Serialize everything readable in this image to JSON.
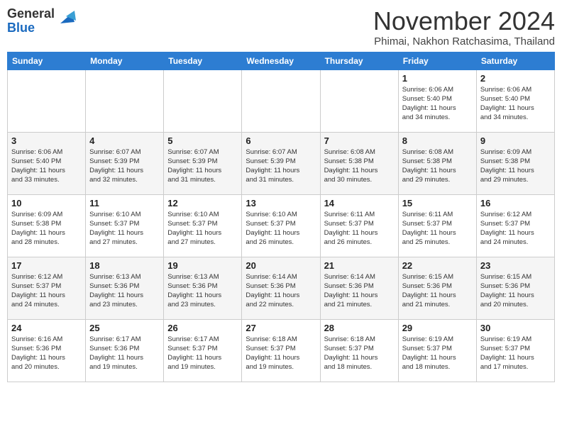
{
  "header": {
    "logo_line1": "General",
    "logo_line2": "Blue",
    "month_title": "November 2024",
    "subtitle": "Phimai, Nakhon Ratchasima, Thailand"
  },
  "weekdays": [
    "Sunday",
    "Monday",
    "Tuesday",
    "Wednesday",
    "Thursday",
    "Friday",
    "Saturday"
  ],
  "weeks": [
    [
      {
        "day": "",
        "info": ""
      },
      {
        "day": "",
        "info": ""
      },
      {
        "day": "",
        "info": ""
      },
      {
        "day": "",
        "info": ""
      },
      {
        "day": "",
        "info": ""
      },
      {
        "day": "1",
        "info": "Sunrise: 6:06 AM\nSunset: 5:40 PM\nDaylight: 11 hours\nand 34 minutes."
      },
      {
        "day": "2",
        "info": "Sunrise: 6:06 AM\nSunset: 5:40 PM\nDaylight: 11 hours\nand 34 minutes."
      }
    ],
    [
      {
        "day": "3",
        "info": "Sunrise: 6:06 AM\nSunset: 5:40 PM\nDaylight: 11 hours\nand 33 minutes."
      },
      {
        "day": "4",
        "info": "Sunrise: 6:07 AM\nSunset: 5:39 PM\nDaylight: 11 hours\nand 32 minutes."
      },
      {
        "day": "5",
        "info": "Sunrise: 6:07 AM\nSunset: 5:39 PM\nDaylight: 11 hours\nand 31 minutes."
      },
      {
        "day": "6",
        "info": "Sunrise: 6:07 AM\nSunset: 5:39 PM\nDaylight: 11 hours\nand 31 minutes."
      },
      {
        "day": "7",
        "info": "Sunrise: 6:08 AM\nSunset: 5:38 PM\nDaylight: 11 hours\nand 30 minutes."
      },
      {
        "day": "8",
        "info": "Sunrise: 6:08 AM\nSunset: 5:38 PM\nDaylight: 11 hours\nand 29 minutes."
      },
      {
        "day": "9",
        "info": "Sunrise: 6:09 AM\nSunset: 5:38 PM\nDaylight: 11 hours\nand 29 minutes."
      }
    ],
    [
      {
        "day": "10",
        "info": "Sunrise: 6:09 AM\nSunset: 5:38 PM\nDaylight: 11 hours\nand 28 minutes."
      },
      {
        "day": "11",
        "info": "Sunrise: 6:10 AM\nSunset: 5:37 PM\nDaylight: 11 hours\nand 27 minutes."
      },
      {
        "day": "12",
        "info": "Sunrise: 6:10 AM\nSunset: 5:37 PM\nDaylight: 11 hours\nand 27 minutes."
      },
      {
        "day": "13",
        "info": "Sunrise: 6:10 AM\nSunset: 5:37 PM\nDaylight: 11 hours\nand 26 minutes."
      },
      {
        "day": "14",
        "info": "Sunrise: 6:11 AM\nSunset: 5:37 PM\nDaylight: 11 hours\nand 26 minutes."
      },
      {
        "day": "15",
        "info": "Sunrise: 6:11 AM\nSunset: 5:37 PM\nDaylight: 11 hours\nand 25 minutes."
      },
      {
        "day": "16",
        "info": "Sunrise: 6:12 AM\nSunset: 5:37 PM\nDaylight: 11 hours\nand 24 minutes."
      }
    ],
    [
      {
        "day": "17",
        "info": "Sunrise: 6:12 AM\nSunset: 5:37 PM\nDaylight: 11 hours\nand 24 minutes."
      },
      {
        "day": "18",
        "info": "Sunrise: 6:13 AM\nSunset: 5:36 PM\nDaylight: 11 hours\nand 23 minutes."
      },
      {
        "day": "19",
        "info": "Sunrise: 6:13 AM\nSunset: 5:36 PM\nDaylight: 11 hours\nand 23 minutes."
      },
      {
        "day": "20",
        "info": "Sunrise: 6:14 AM\nSunset: 5:36 PM\nDaylight: 11 hours\nand 22 minutes."
      },
      {
        "day": "21",
        "info": "Sunrise: 6:14 AM\nSunset: 5:36 PM\nDaylight: 11 hours\nand 21 minutes."
      },
      {
        "day": "22",
        "info": "Sunrise: 6:15 AM\nSunset: 5:36 PM\nDaylight: 11 hours\nand 21 minutes."
      },
      {
        "day": "23",
        "info": "Sunrise: 6:15 AM\nSunset: 5:36 PM\nDaylight: 11 hours\nand 20 minutes."
      }
    ],
    [
      {
        "day": "24",
        "info": "Sunrise: 6:16 AM\nSunset: 5:36 PM\nDaylight: 11 hours\nand 20 minutes."
      },
      {
        "day": "25",
        "info": "Sunrise: 6:17 AM\nSunset: 5:36 PM\nDaylight: 11 hours\nand 19 minutes."
      },
      {
        "day": "26",
        "info": "Sunrise: 6:17 AM\nSunset: 5:37 PM\nDaylight: 11 hours\nand 19 minutes."
      },
      {
        "day": "27",
        "info": "Sunrise: 6:18 AM\nSunset: 5:37 PM\nDaylight: 11 hours\nand 19 minutes."
      },
      {
        "day": "28",
        "info": "Sunrise: 6:18 AM\nSunset: 5:37 PM\nDaylight: 11 hours\nand 18 minutes."
      },
      {
        "day": "29",
        "info": "Sunrise: 6:19 AM\nSunset: 5:37 PM\nDaylight: 11 hours\nand 18 minutes."
      },
      {
        "day": "30",
        "info": "Sunrise: 6:19 AM\nSunset: 5:37 PM\nDaylight: 11 hours\nand 17 minutes."
      }
    ]
  ]
}
